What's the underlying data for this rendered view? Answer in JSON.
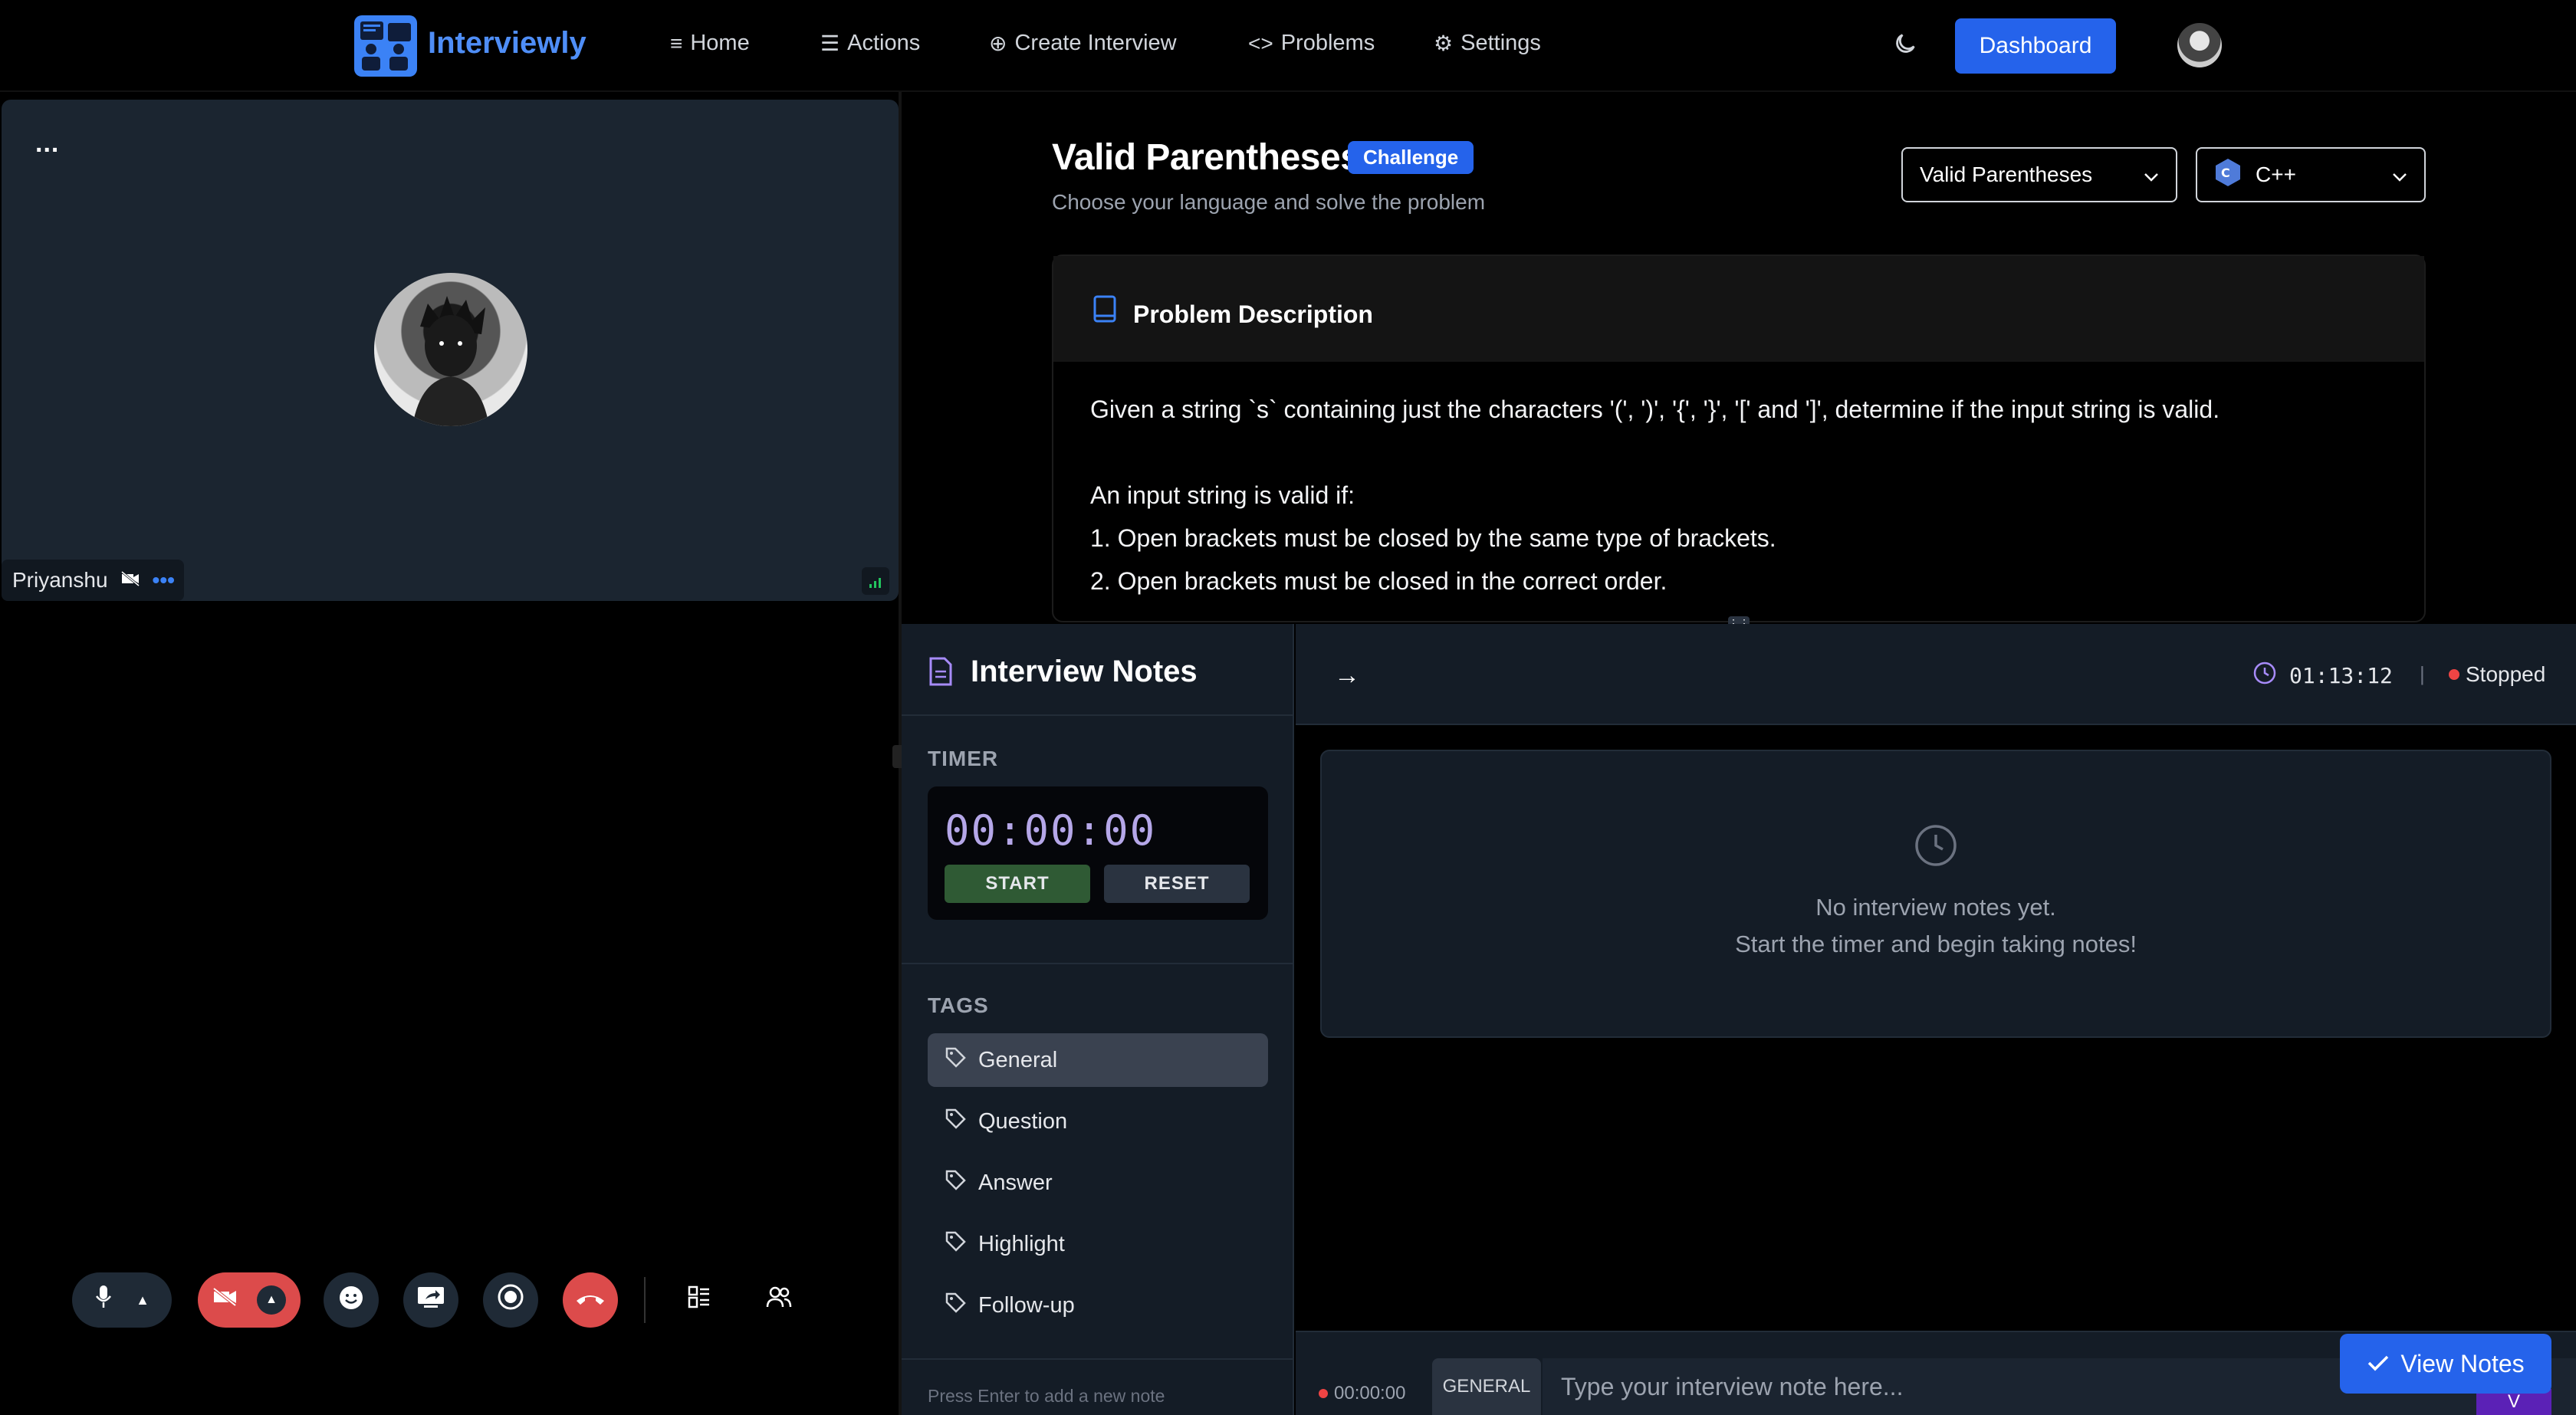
{
  "nav": {
    "brand": "Interviewly",
    "items": [
      {
        "label": "Home",
        "icon": "menu-icon"
      },
      {
        "label": "Actions",
        "icon": "list-check-icon"
      },
      {
        "label": "Create Interview",
        "icon": "plus-circle-icon"
      },
      {
        "label": "Problems",
        "icon": "code-icon"
      },
      {
        "label": "Settings",
        "icon": "gear-icon"
      }
    ],
    "dashboard_label": "Dashboard",
    "theme_icon": "moon-icon"
  },
  "video": {
    "participant_name": "Priyanshu",
    "menu_label": "..."
  },
  "problem": {
    "title": "Valid Parentheses",
    "badge": "Challenge",
    "subtitle": "Choose your language and solve the problem",
    "problem_select": "Valid Parentheses",
    "language_select": "C++",
    "card_title": "Problem Description",
    "lines": [
      "Given a string `s` containing just the characters '(', ')', '{', '}', '[' and ']', determine if the input string is valid.",
      "An input string is valid if:",
      "1. Open brackets must be closed by the same type of brackets.",
      "2. Open brackets must be closed in the correct order."
    ]
  },
  "notes": {
    "title": "Interview Notes",
    "timer_label": "TIMER",
    "timer_value": "00:00:00",
    "start_label": "START",
    "reset_label": "RESET",
    "tags_label": "TAGS",
    "tags": [
      "General",
      "Question",
      "Answer",
      "Highlight",
      "Follow-up"
    ],
    "active_tag": "General",
    "hint": "Press Enter to add a new note",
    "session_time": "01:13:12",
    "separator": "|",
    "status": "Stopped",
    "empty_line1": "No interview notes yet.",
    "empty_line2": "Start the timer and begin taking notes!",
    "note_time": "00:00:00",
    "note_tag": "GENERAL",
    "note_placeholder": "Type your interview note here...",
    "view_notes_label": "View Notes",
    "corner_glyph": "V"
  },
  "colors": {
    "accent": "#2563eb",
    "brand": "#4f8ef7",
    "danger": "#dc4b4b",
    "timer_digits": "#b5a7e8",
    "start_btn": "#2f5a34"
  }
}
